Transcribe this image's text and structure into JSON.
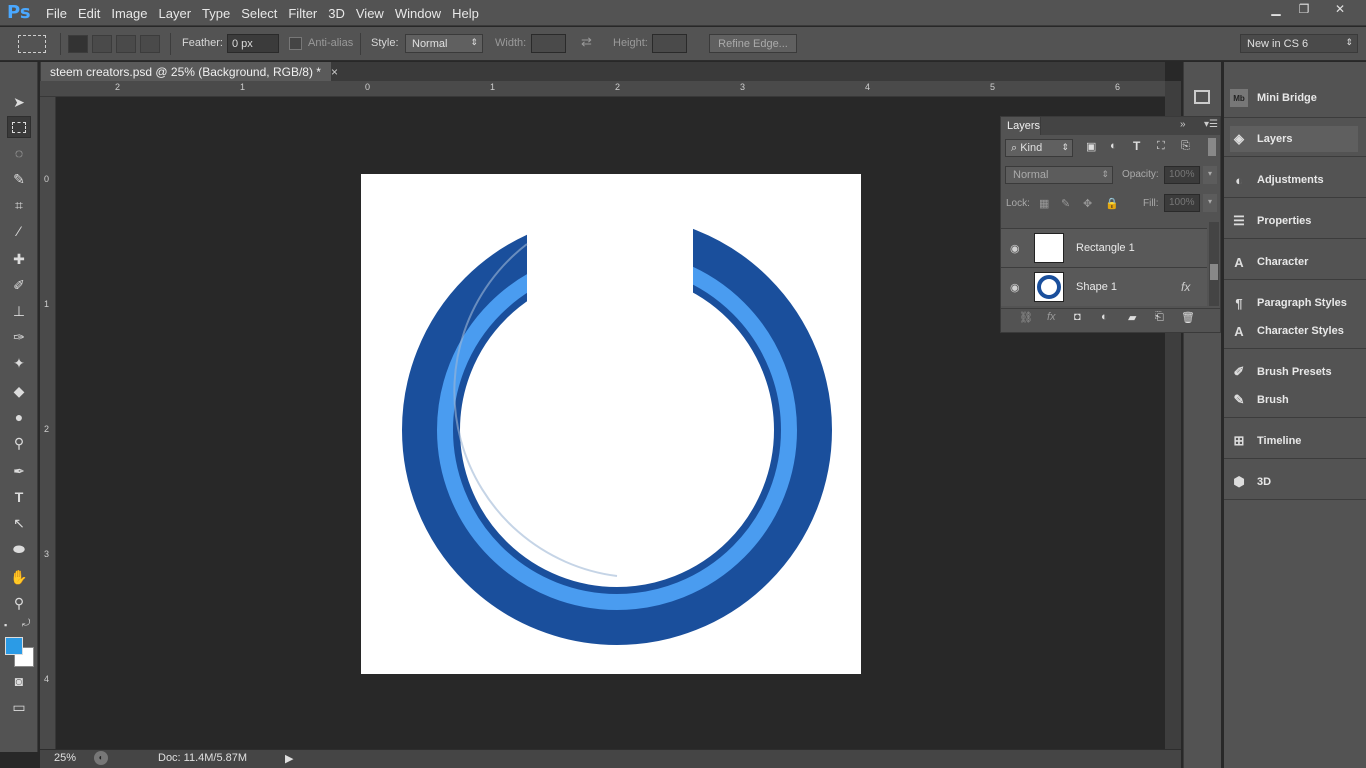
{
  "app": {
    "logo": "Ps"
  },
  "menu": [
    "File",
    "Edit",
    "Image",
    "Layer",
    "Type",
    "Select",
    "Filter",
    "3D",
    "View",
    "Window",
    "Help"
  ],
  "options": {
    "feather_label": "Feather:",
    "feather_value": "0 px",
    "antialias_label": "Anti-alias",
    "style_label": "Style:",
    "style_value": "Normal",
    "width_label": "Width:",
    "height_label": "Height:",
    "refine_edge": "Refine Edge...",
    "workspace": "New in CS 6"
  },
  "document": {
    "tab_title": "steem creators.psd @ 25% (Background, RGB/8) *",
    "zoom": "25%",
    "doc_size": "Doc: 11.4M/5.87M"
  },
  "rulers": {
    "top": [
      "2",
      "1",
      "0",
      "1",
      "2",
      "3",
      "4",
      "5",
      "6"
    ],
    "left": [
      "0",
      "1",
      "2",
      "3",
      "4"
    ]
  },
  "colors": {
    "foreground": "#2b9be6",
    "background": "#ffffff",
    "ring_dark": "#1a4f9c",
    "ring_light": "#4a9cf0"
  },
  "layers_panel": {
    "tab": "Layers",
    "filter_kind": "Kind",
    "blend_mode": "Normal",
    "opacity_label": "Opacity:",
    "opacity_value": "100%",
    "lock_label": "Lock:",
    "fill_label": "Fill:",
    "fill_value": "100%",
    "layers": [
      {
        "name": "Rectangle 1",
        "visible": true
      },
      {
        "name": "Shape 1",
        "visible": true,
        "fx": "fx"
      }
    ]
  },
  "dock": [
    {
      "label": "Mini Bridge",
      "icon": "mini-bridge-icon"
    },
    {
      "label": "Layers",
      "icon": "layers-icon"
    },
    {
      "label": "Adjustments",
      "icon": "adjustments-icon"
    },
    {
      "label": "Properties",
      "icon": "properties-icon"
    },
    {
      "label": "Character",
      "icon": "character-icon"
    },
    {
      "label": "Paragraph Styles",
      "icon": "paragraph-styles-icon"
    },
    {
      "label": "Character Styles",
      "icon": "character-styles-icon"
    },
    {
      "label": "Brush Presets",
      "icon": "brush-presets-icon"
    },
    {
      "label": "Brush",
      "icon": "brush-icon"
    },
    {
      "label": "Timeline",
      "icon": "timeline-icon"
    },
    {
      "label": "3D",
      "icon": "3d-icon"
    }
  ]
}
